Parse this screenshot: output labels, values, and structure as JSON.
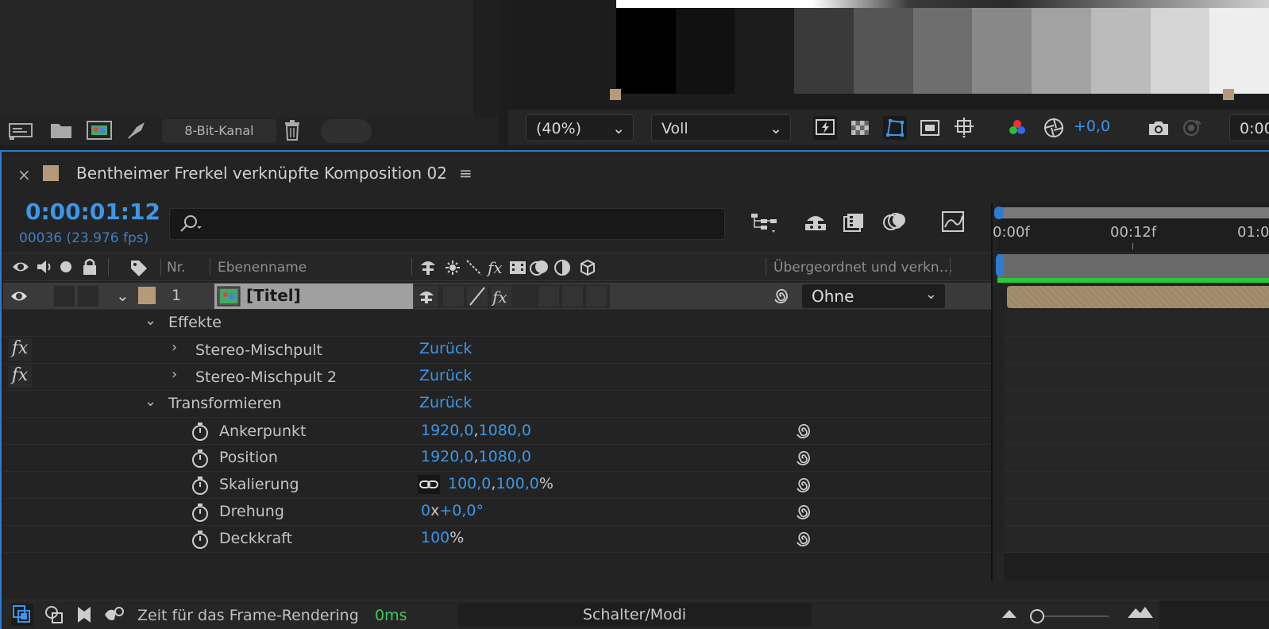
{
  "project": {
    "bit_depth": "8-Bit-Kanal"
  },
  "viewer": {
    "zoom": "(40%)",
    "resolution": "Voll",
    "exposure": "+0,0",
    "timecode_partial": "0:00",
    "gray_swatches": [
      "#000000",
      "#111111",
      "#1c1c1c",
      "#3a3a3a",
      "#555555",
      "#6e6e6e",
      "#888888",
      "#a2a2a2",
      "#bbbbbb",
      "#d5d5d5",
      "#eeeeee"
    ]
  },
  "timeline": {
    "close": "×",
    "title": "Bentheimer Frerkel verknüpfte Komposition 02",
    "menu": "≡",
    "timecode": "0:00:01:12",
    "frames": "00036 (23.976 fps)",
    "ruler": [
      "0:00f",
      "00:12f",
      "01:0"
    ],
    "columns": {
      "nr": "Nr.",
      "layer_name": "Ebenenname",
      "parent": "Übergeordnet und verkn…"
    },
    "layer": {
      "number": "1",
      "name": "[Titel]",
      "parent": "Ohne",
      "label_color": "#b49a78"
    },
    "effects_group": "Effekte",
    "effects": [
      {
        "name": "Stereo-Mischpult",
        "value": "Zurück"
      },
      {
        "name": "Stereo-Mischpult 2",
        "value": "Zurück"
      }
    ],
    "transform": {
      "name": "Transformieren",
      "value": "Zurück"
    },
    "properties": [
      {
        "name": "Ankerpunkt",
        "v1": "1920,0",
        "sep": ",",
        "v2": "1080,0",
        "suffix": ""
      },
      {
        "name": "Position",
        "v1": "1920,0",
        "sep": ",",
        "v2": "1080,0",
        "suffix": ""
      },
      {
        "name": "Skalierung",
        "v1": "100,0",
        "sep": ",",
        "v2": "100,0",
        "suffix": "%"
      },
      {
        "name": "Drehung",
        "v1": "0",
        "sep": "x",
        "v2": "+0,0",
        "suffix": "°"
      },
      {
        "name": "Deckkraft",
        "v1": "100",
        "sep": "",
        "v2": "",
        "suffix": "%"
      }
    ],
    "fx": "fx"
  },
  "bottom": {
    "render_label": "Zeit für das Frame-Rendering",
    "render_value": "0ms",
    "modes": "Schalter/Modi"
  },
  "colors": {
    "accent": "#3d96e8",
    "green": "#3fc85a",
    "clip": "#a48e6e"
  }
}
